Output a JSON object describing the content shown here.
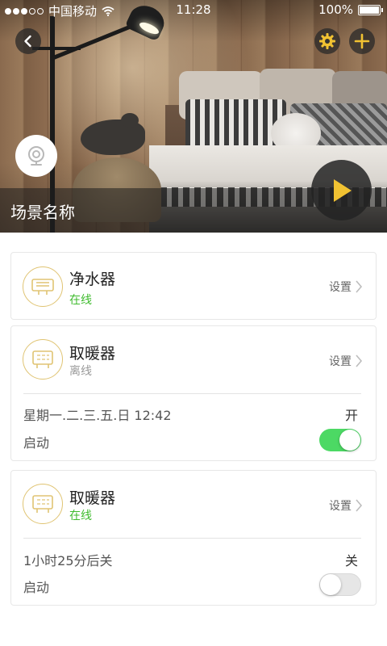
{
  "status_bar": {
    "carrier": "中国移动",
    "time": "11:28",
    "battery": "100%"
  },
  "header": {
    "scene_name": "场景名称",
    "icons": {
      "back": "chevron-left-icon",
      "settings": "gear-icon",
      "add": "plus-icon",
      "scene": "camera-icon",
      "play": "play-icon"
    }
  },
  "devices": [
    {
      "name": "净水器",
      "status": "在线",
      "settings_label": "设置"
    },
    {
      "name": "取暖器",
      "status": "离线",
      "settings_label": "设置",
      "schedule": {
        "time": "星期一.二.三.五.日 12:42",
        "state": "开",
        "label": "启动",
        "enabled": true
      }
    },
    {
      "name": "取暖器",
      "status": "在线",
      "settings_label": "设置",
      "schedule": {
        "time": "1小时25分后关",
        "state": "关",
        "label": "启动",
        "enabled": false
      }
    }
  ],
  "colors": {
    "online": "#3fbb2e",
    "offline": "#9a9a9a",
    "accent": "#f1c232",
    "toggle_on": "#4cd964"
  }
}
